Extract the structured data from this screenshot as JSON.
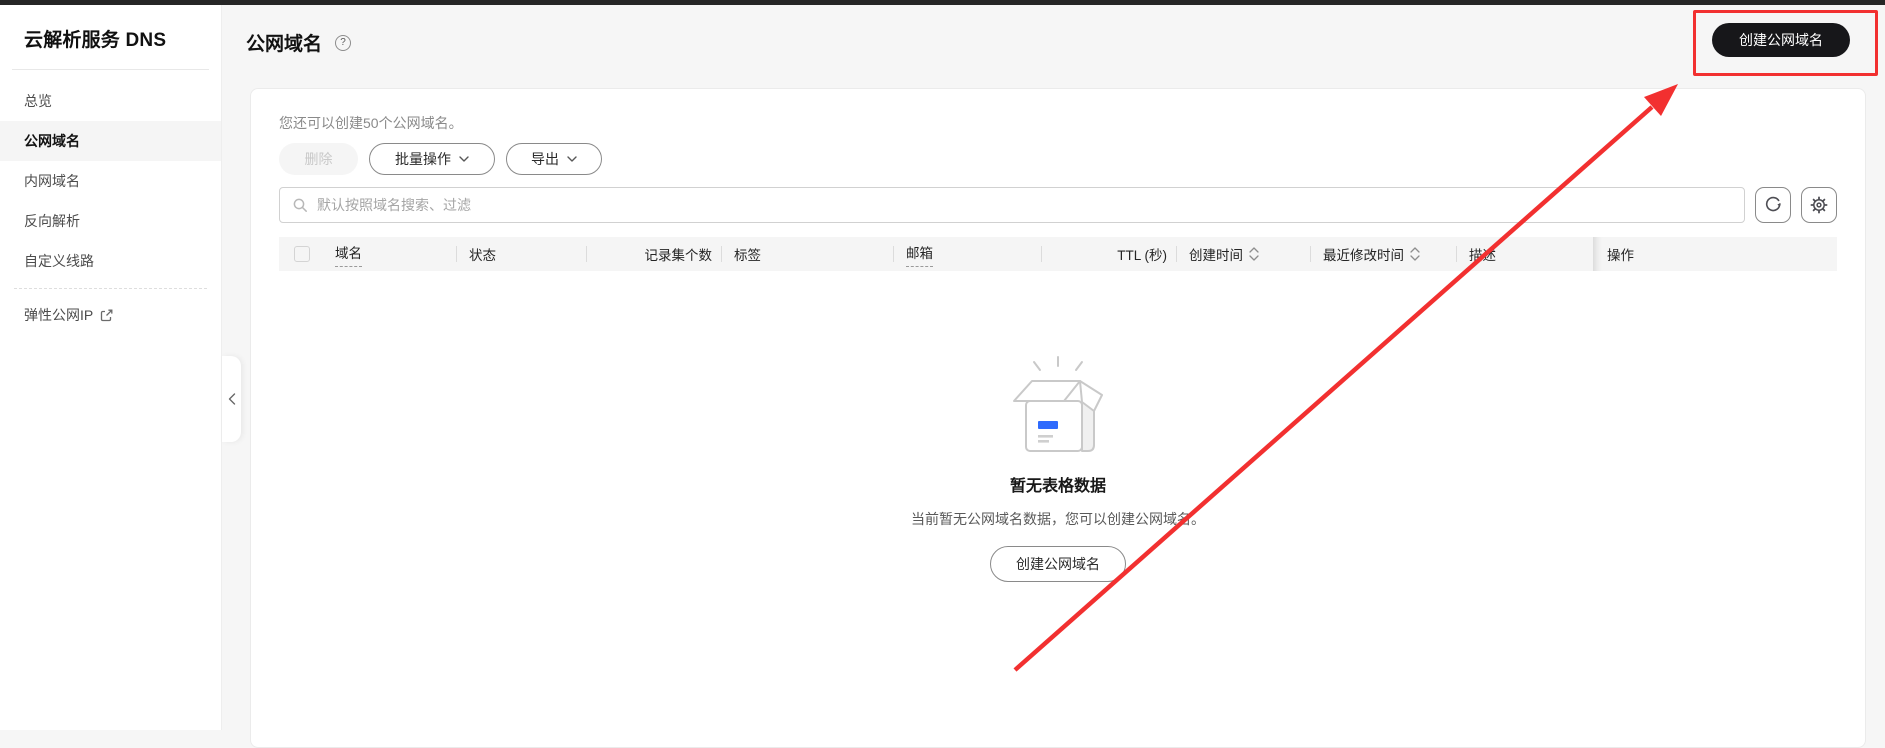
{
  "sidebar": {
    "title": "云解析服务 DNS",
    "items": [
      {
        "key": "overview",
        "label": "总览",
        "active": false
      },
      {
        "key": "public-zone",
        "label": "公网域名",
        "active": true
      },
      {
        "key": "private-zone",
        "label": "内网域名",
        "active": false
      },
      {
        "key": "ptr-record",
        "label": "反向解析",
        "active": false
      },
      {
        "key": "custom-line",
        "label": "自定义线路",
        "active": false
      }
    ],
    "external_item": {
      "key": "eip",
      "label": "弹性公网IP"
    }
  },
  "page": {
    "title": "公网域名",
    "create_button_label": "创建公网域名"
  },
  "toolbar": {
    "quota_text": "您还可以创建50个公网域名。",
    "delete_label": "删除",
    "batch_label": "批量操作",
    "export_label": "导出"
  },
  "search": {
    "placeholder": "默认按照域名搜索、过滤",
    "value": ""
  },
  "table": {
    "columns": [
      {
        "key": "domain",
        "label": "域名",
        "dashed": true
      },
      {
        "key": "status",
        "label": "状态"
      },
      {
        "key": "recordsets",
        "label": "记录集个数",
        "align": "right"
      },
      {
        "key": "tags",
        "label": "标签"
      },
      {
        "key": "email",
        "label": "邮箱",
        "dashed": true
      },
      {
        "key": "ttl",
        "label": "TTL (秒)",
        "align": "right"
      },
      {
        "key": "created",
        "label": "创建时间",
        "sortable": true
      },
      {
        "key": "modified",
        "label": "最近修改时间",
        "sortable": true
      },
      {
        "key": "description",
        "label": "描述"
      },
      {
        "key": "operation",
        "label": "操作"
      }
    ],
    "rows": []
  },
  "empty_state": {
    "title": "暂无表格数据",
    "description": "当前暂无公网域名数据，您可以创建公网域名。",
    "button_label": "创建公网域名"
  },
  "annotation": {
    "highlight_color": "#f23030"
  },
  "colors": {
    "primary_button_bg": "#17171a",
    "accent_red": "#f23030",
    "active_item_bg": "#f5f5f5",
    "table_header_bg": "#f5f5f5",
    "empty_box_blue": "#2f6bfd"
  },
  "icons": {
    "help": "question-circle",
    "search": "magnifier",
    "refresh": "circular-arrow",
    "settings": "gear",
    "sort": "up-down-chevrons",
    "external": "external-link",
    "collapse": "chevron-left",
    "dropdown": "chevron-down",
    "empty": "open-box"
  }
}
